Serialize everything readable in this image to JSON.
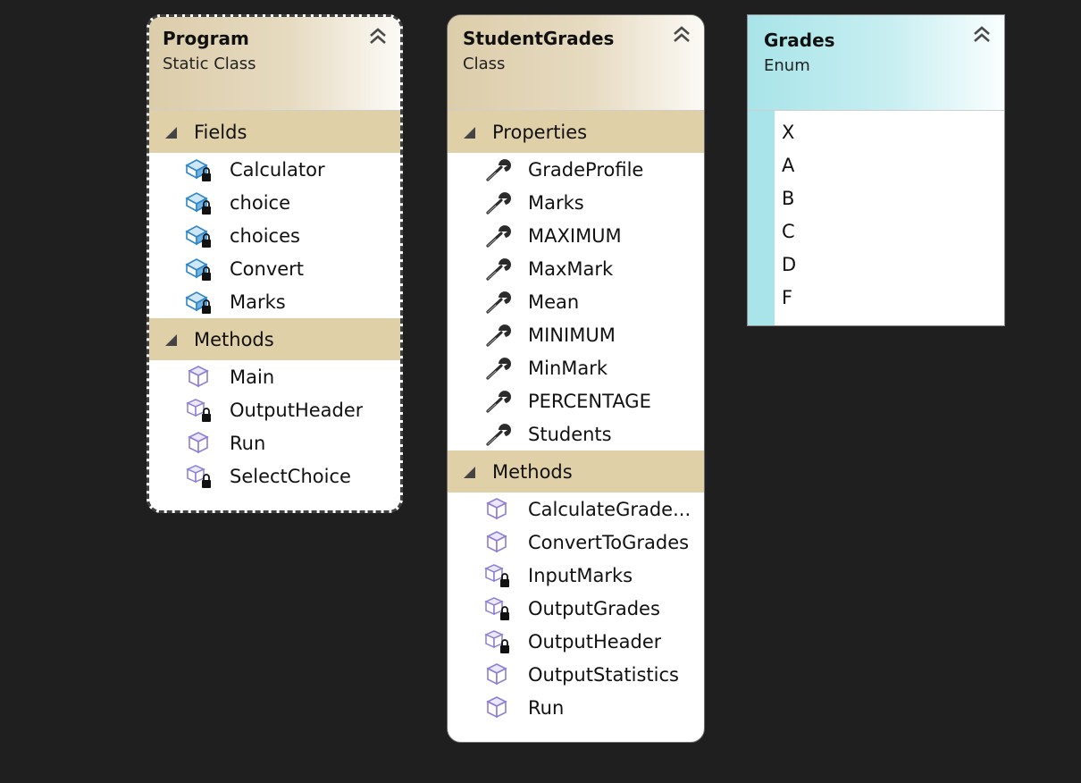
{
  "program": {
    "title": "Program",
    "subtitle": "Static Class",
    "sections": {
      "fields": {
        "label": "Fields",
        "items": [
          "Calculator",
          "choice",
          "choices",
          "Convert",
          "Marks"
        ]
      },
      "methods": {
        "label": "Methods",
        "items": [
          {
            "label": "Main",
            "icon": "public-method-icon"
          },
          {
            "label": "OutputHeader",
            "icon": "private-method-icon"
          },
          {
            "label": "Run",
            "icon": "public-method-icon"
          },
          {
            "label": "SelectChoice",
            "icon": "private-method-icon"
          }
        ]
      }
    }
  },
  "studentgrades": {
    "title": "StudentGrades",
    "subtitle": "Class",
    "sections": {
      "properties": {
        "label": "Properties",
        "items": [
          "GradeProfile",
          "Marks",
          "MAXIMUM",
          "MaxMark",
          "Mean",
          "MINIMUM",
          "MinMark",
          "PERCENTAGE",
          "Students"
        ]
      },
      "methods": {
        "label": "Methods",
        "items": [
          {
            "label": "CalculateGrade...",
            "icon": "public-method-icon"
          },
          {
            "label": "ConvertToGrades",
            "icon": "public-method-icon"
          },
          {
            "label": "InputMarks",
            "icon": "private-method-icon"
          },
          {
            "label": "OutputGrades",
            "icon": "private-method-icon"
          },
          {
            "label": "OutputHeader",
            "icon": "private-method-icon"
          },
          {
            "label": "OutputStatistics",
            "icon": "public-method-icon"
          },
          {
            "label": "Run",
            "icon": "public-method-icon"
          }
        ]
      }
    }
  },
  "grades": {
    "title": "Grades",
    "subtitle": "Enum",
    "values": [
      "X",
      "A",
      "B",
      "C",
      "D",
      "F"
    ]
  },
  "colors": {
    "canvas": "#1f1f1f",
    "class_header": "#dccdaa",
    "section_header": "#e0d0a8",
    "enum_header": "#a8e4e9",
    "method_icon": "#8a7fd6",
    "field_icon": "#2d86c9"
  }
}
